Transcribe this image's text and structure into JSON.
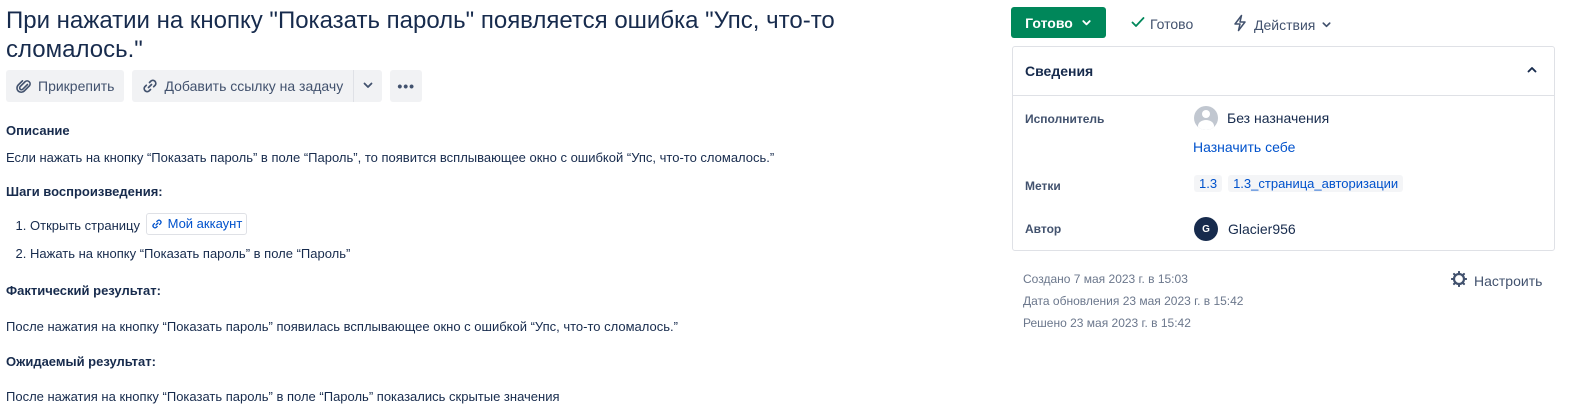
{
  "issue": {
    "title": "При нажатии на кнопку \"Показать пароль\" появляется ошибка \"Упс, что-то сломалось.\""
  },
  "toolbar": {
    "attach_label": "Прикрепить",
    "link_issue_label": "Добавить ссылку на задачу",
    "more_label": "•••"
  },
  "content": {
    "description_heading": "Описание",
    "description_text": "Если нажать на кнопку “Показать пароль” в поле “Пароль”, то появится всплывающее окно с ошибкой “Упс, что-то сломалось.”",
    "steps_heading": "Шаги воспроизведения:",
    "steps": [
      {
        "text": "Открыть страницу",
        "link": "Мой аккаунт"
      },
      {
        "text": "Нажать на кнопку “Показать пароль” в поле “Пароль”"
      }
    ],
    "actual_heading": "Фактический результат:",
    "actual_text": "После нажатия на кнопку “Показать пароль” появилась всплывающее окно с ошибкой “Упс, что-то сломалось.”",
    "expected_heading": "Ожидаемый результат:",
    "expected_text": "После нажатия на кнопку “Показать пароль” в поле “Пароль” показались скрытые значения"
  },
  "status": {
    "current": "Готово",
    "resolution": "Готово",
    "actions_label": "Действия",
    "color": "#00875a"
  },
  "details": {
    "heading": "Сведения",
    "assignee_label": "Исполнитель",
    "assignee_value": "Без назначения",
    "assign_self_label": "Назначить себе",
    "labels_label": "Метки",
    "labels": [
      "1.3",
      "1.3_страница_авторизации"
    ],
    "reporter_label": "Автор",
    "reporter_initial": "G",
    "reporter_name": "Glacier956"
  },
  "meta": {
    "created": "Создано 7 мая 2023 г. в 15:03",
    "updated": "Дата обновления 23 мая 2023 г. в 15:42",
    "resolved": "Решено 23 мая 2023 г. в 15:42",
    "configure_label": "Настроить"
  },
  "colors": {
    "link": "#0052cc",
    "text": "#172b4d",
    "muted": "#6b778c"
  }
}
